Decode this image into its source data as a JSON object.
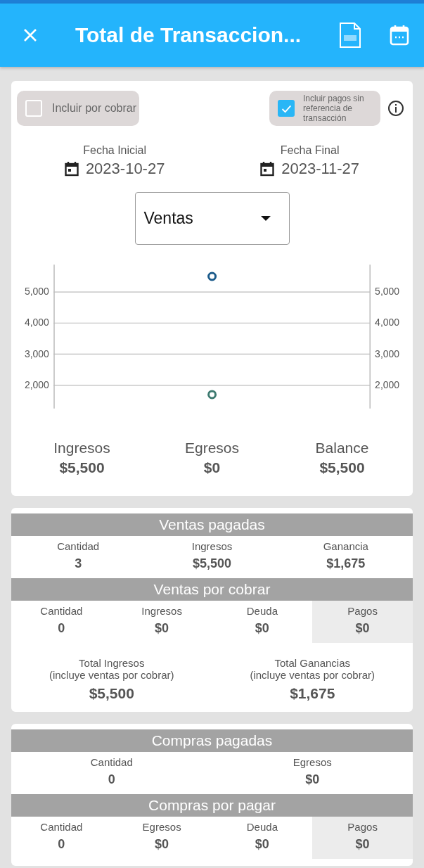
{
  "header": {
    "title": "Total de Transaccion..."
  },
  "filters": [
    {
      "label": "Incluir por cobrar",
      "checked": false
    },
    {
      "label": "Incluir pagos sin referencia de transacción",
      "checked": true
    }
  ],
  "dates": [
    {
      "label": "Fecha Inicial",
      "value": "2023-10-27"
    },
    {
      "label": "Fecha Final",
      "value": "2023-11-27"
    }
  ],
  "dropdown": {
    "value": "Ventas"
  },
  "chart_data": {
    "type": "scatter",
    "grid": true,
    "ylim": [
      1250,
      5880
    ],
    "yticks": [
      {
        "value": 2000,
        "label": "2,000"
      },
      {
        "value": 3000,
        "label": "3,000"
      },
      {
        "value": 4000,
        "label": "4,000"
      },
      {
        "value": 5000,
        "label": "5,000"
      }
    ],
    "series": [
      {
        "color": "#1a5a8a",
        "values": [
          5500
        ]
      },
      {
        "color": "#3d7a70",
        "values": [
          1700
        ]
      }
    ]
  },
  "summary": [
    {
      "label": "Ingresos",
      "value": "$5,500"
    },
    {
      "label": "Egresos",
      "value": "$0"
    },
    {
      "label": "Balance",
      "value": "$5,500"
    }
  ],
  "cards": [
    {
      "groups": [
        {
          "title": "Ventas pagadas",
          "stats": [
            {
              "label": "Cantidad",
              "value": "3",
              "highlighted": false
            },
            {
              "label": "Ingresos",
              "value": "$5,500",
              "highlighted": false
            },
            {
              "label": "Ganancia",
              "value": "$1,675",
              "highlighted": false
            }
          ]
        },
        {
          "title": "Ventas por cobrar",
          "stats": [
            {
              "label": "Cantidad",
              "value": "0",
              "highlighted": false
            },
            {
              "label": "Ingresos",
              "value": "$0",
              "highlighted": false
            },
            {
              "label": "Deuda",
              "value": "$0",
              "highlighted": false
            },
            {
              "label": "Pagos",
              "value": "$0",
              "highlighted": true
            }
          ]
        }
      ],
      "totals": [
        {
          "label": "Total Ingresos",
          "note": "(incluye ventas por cobrar)",
          "value": "$5,500"
        },
        {
          "label": "Total Ganancias",
          "note": "(incluye ventas por cobrar)",
          "value": "$1,675"
        }
      ]
    },
    {
      "groups": [
        {
          "title": "Compras pagadas",
          "stats": [
            {
              "label": "Cantidad",
              "value": "0",
              "highlighted": false
            },
            {
              "label": "Egresos",
              "value": "$0",
              "highlighted": false
            }
          ]
        },
        {
          "title": "Compras por pagar",
          "stats": [
            {
              "label": "Cantidad",
              "value": "0",
              "highlighted": false
            },
            {
              "label": "Egresos",
              "value": "$0",
              "highlighted": false
            },
            {
              "label": "Deuda",
              "value": "$0",
              "highlighted": false
            },
            {
              "label": "Pagos",
              "value": "$0",
              "highlighted": true
            }
          ]
        }
      ]
    }
  ]
}
